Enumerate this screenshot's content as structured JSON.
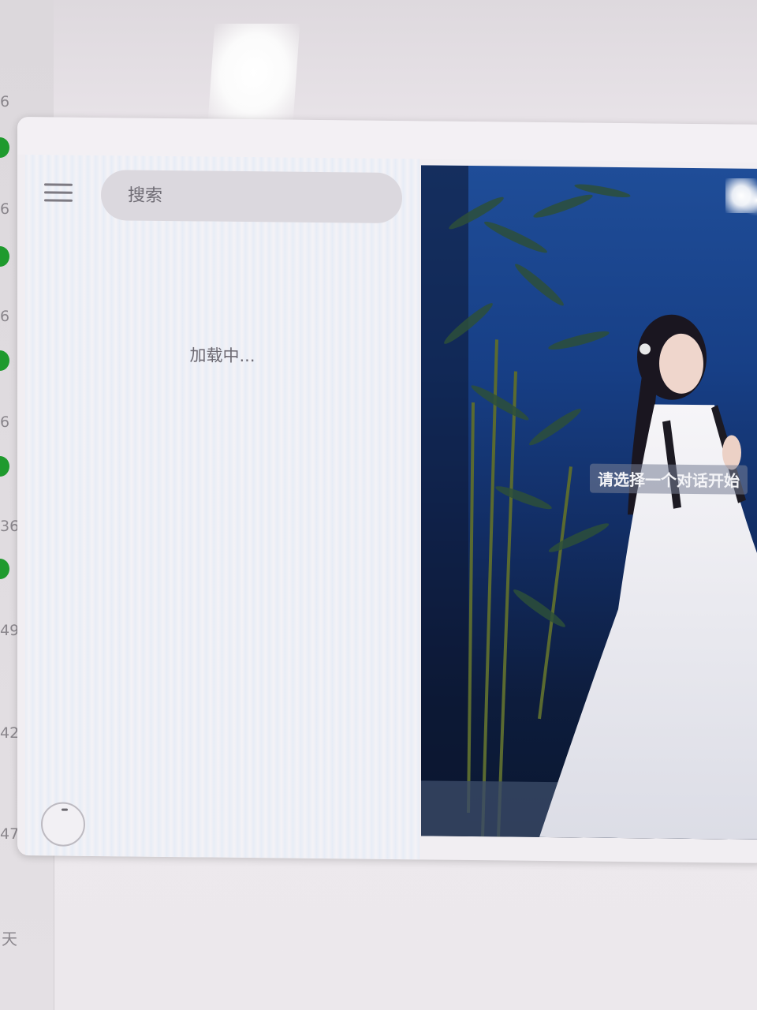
{
  "background": {
    "edge_numbers": [
      "6",
      "6",
      "6",
      "6",
      "36",
      "49",
      "42",
      "47"
    ],
    "edge_text": "天",
    "status_dot_color": "#1f9a2e"
  },
  "sidebar": {
    "menu_icon": "hamburger-menu-icon",
    "search": {
      "placeholder": "搜索"
    },
    "loading_text": "加载中...",
    "avatar_icon": "avatar-icon"
  },
  "chat": {
    "empty_state_text": "请选择一个对话开始",
    "wallpaper": "bamboo-night-figure-wallpaper"
  }
}
